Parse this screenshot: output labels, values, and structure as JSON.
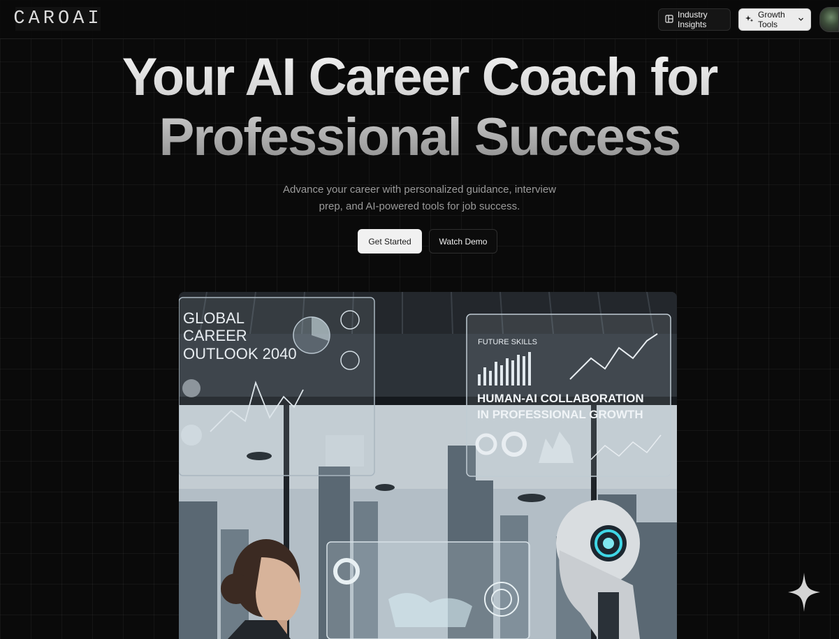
{
  "header": {
    "logo": "CAROAI",
    "nav": {
      "industry_insights": "Industry Insights",
      "growth_tools": "Growth Tools"
    },
    "icons": {
      "insights": "layout-dashboard-icon",
      "growth": "stars-icon",
      "chevron": "chevron-down-icon"
    }
  },
  "hero": {
    "title_line1": "Your AI Career Coach for",
    "title_line2": "Professional Success",
    "subtitle_line1": "Advance your career with personalized guidance, interview",
    "subtitle_line2": "prep, and AI-powered tools for job success.",
    "primary_button": "Get Started",
    "secondary_button": "Watch Demo"
  },
  "banner": {
    "left_panel_title_1": "GLOBAL",
    "left_panel_title_2": "CAREER",
    "left_panel_title_3": "OUTLOOK 2040",
    "right_panel_label": "FUTURE SKILLS",
    "right_panel_title_1": "HUMAN-AI COLLABORATION",
    "right_panel_title_2": "IN PROFESSIONAL GROWTH"
  },
  "colors": {
    "background": "#0a0a0a",
    "primary_button": "#f1f1f1",
    "accent_cyan": "#3fd7e6"
  }
}
